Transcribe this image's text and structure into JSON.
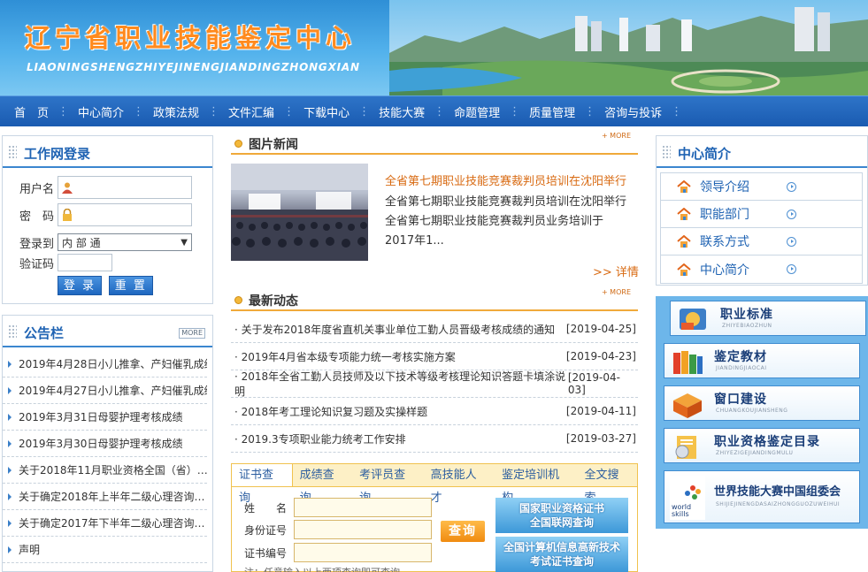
{
  "header": {
    "title": "辽宁省职业技能鉴定中心",
    "pinyin": "LIAONINGSHENGZHIYEJINENGJIANDINGZHONGXIAN"
  },
  "nav": [
    "首　页",
    "中心简介",
    "政策法规",
    "文件汇编",
    "下载中心",
    "技能大赛",
    "命题管理",
    "质量管理",
    "咨询与投诉"
  ],
  "login": {
    "title": "工作网登录",
    "username_label": "用户名",
    "password_label": "密　码",
    "login_to_label": "登录到",
    "login_to_value": "内 部 通",
    "captcha_label": "验证码",
    "login_button": "登 录",
    "reset_button": "重 置"
  },
  "notice": {
    "title": "公告栏",
    "more": "MORE",
    "items": [
      "2019年4月28日小儿推拿、产妇催乳成绩",
      "2019年4月27日小儿推拿、产妇催乳成绩",
      "2019年3月31日母婴护理考核成绩",
      "2019年3月30日母婴护理考核成绩",
      "关于2018年11月职业资格全国（省）…",
      "关于确定2018年上半年二级心理咨询…",
      "关于确定2017年下半年二级心理咨询…",
      "声明"
    ]
  },
  "photo_news": {
    "title": "图片新闻",
    "more": "+ MORE",
    "headline": "全省第七期职业技能竞赛裁判员培训在沈阳举行",
    "summary": "全省第七期职业技能竞赛裁判员培训在沈阳举行 全省第七期职业技能竞赛裁判员业务培训于2017年1...",
    "detail": ">> 详情"
  },
  "latest": {
    "title": "最新动态",
    "more": "+ MORE",
    "items": [
      {
        "text": "· 关于发布2018年度省直机关事业单位工勤人员晋级考核成绩的通知",
        "date": "[2019-04-25]"
      },
      {
        "text": "· 2019年4月省本级专项能力统一考核实施方案",
        "date": "[2019-04-23]"
      },
      {
        "text": "· 2018年全省工勤人员技师及以下技术等级考核理论知识答题卡填涂说明",
        "date": "[2019-04-03]"
      },
      {
        "text": "· 2018年考工理论知识复习题及实操样题",
        "date": "[2019-04-11]"
      },
      {
        "text": "· 2019.3专项职业能力统考工作安排",
        "date": "[2019-03-27]"
      }
    ]
  },
  "query": {
    "tabs": [
      "证书查询",
      "成绩查询",
      "考评员查询",
      "高技能人才",
      "鉴定培训机构",
      "全文搜索"
    ],
    "name_label": "姓　　名",
    "id_label": "身份证号",
    "cert_label": "证书编号",
    "button": "查询",
    "note": "注：任意输入以上两项查询即可查询",
    "link1": "国家职业资格证书\n全国联网查询",
    "link2": "全国计算机信息高新技术\n考试证书查询"
  },
  "intro": {
    "title": "中心简介",
    "items": [
      "领导介绍",
      "职能部门",
      "联系方式",
      "中心简介"
    ]
  },
  "cards": [
    {
      "title": "职业标准",
      "pinyin": "ZHIYEBIAOZHUN",
      "icon": "standard-icon"
    },
    {
      "title": "鉴定教材",
      "pinyin": "JIANDINGJIAOCAI",
      "icon": "books-icon"
    },
    {
      "title": "窗口建设",
      "pinyin": "CHUANGKOUJIANSHENG",
      "icon": "window-icon"
    },
    {
      "title": "职业资格鉴定目录",
      "pinyin": "ZHIYEZIGEJIANDINGMULU",
      "icon": "catalog-icon"
    },
    {
      "title": "世界技能大赛中国组委会",
      "pinyin": "SHIJIEJINENGDASAIZHONGGUOZUWEIHUI",
      "icon": "worldskills-icon"
    }
  ],
  "colors": {
    "nav_blue": "#1a5bb1",
    "accent_orange": "#d86a12",
    "title_blue": "#1f63b3"
  }
}
